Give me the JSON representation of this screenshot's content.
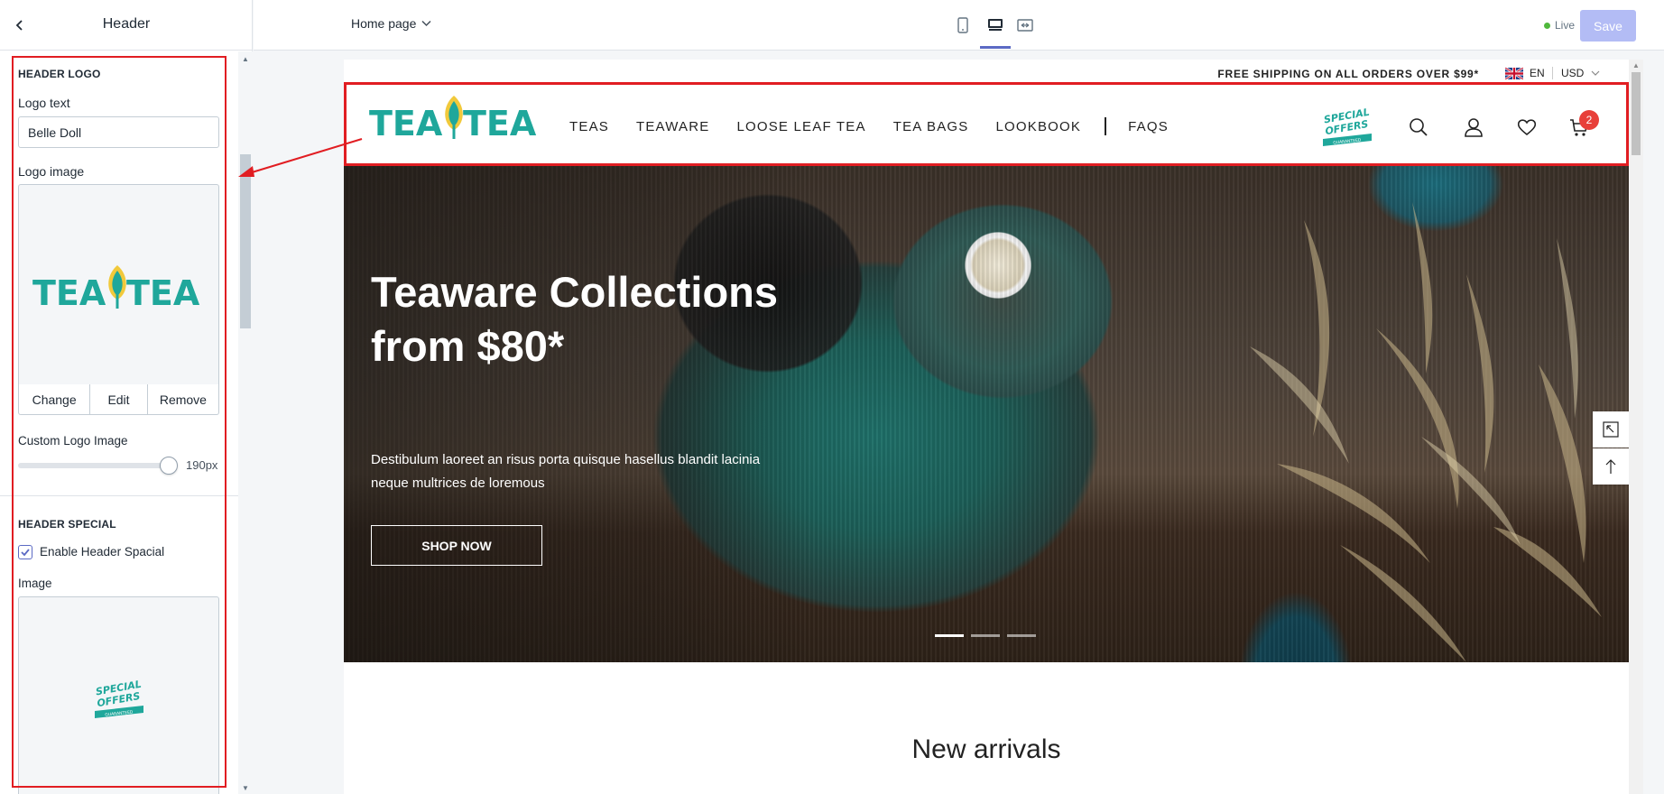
{
  "panel": {
    "title": "Header",
    "logo_section_title": "HEADER LOGO",
    "logo_text_label": "Logo text",
    "logo_text_value": "Belle Doll",
    "logo_image_label": "Logo image",
    "logo_actions": {
      "change": "Change",
      "edit": "Edit",
      "remove": "Remove"
    },
    "custom_logo_label": "Custom Logo Image",
    "custom_logo_value": "190px",
    "custom_logo_slider_fraction": 1.0,
    "special_section_title": "HEADER SPECIAL",
    "enable_special_label": "Enable Header Spacial",
    "enable_special_checked": true,
    "special_image_label": "Image"
  },
  "topbar": {
    "page_select": "Home page",
    "live_label": "Live",
    "save_label": "Save"
  },
  "logo": {
    "left": "TEA",
    "right": "TEA"
  },
  "special_badge": {
    "line1": "SPECIAL",
    "line2": "OFFERS",
    "ribbon": "GUARANTEED"
  },
  "store": {
    "announcement": "FREE SHIPPING ON ALL ORDERS OVER $99*",
    "language": "EN",
    "currency": "USD",
    "nav": [
      "TEAS",
      "TEAWARE",
      "LOOSE LEAF TEA",
      "TEA BAGS",
      "LOOKBOOK",
      "FAQS"
    ],
    "cart_count": "2"
  },
  "hero": {
    "title": "Teaware Collections from $80*",
    "subtitle": "Destibulum laoreet an risus porta quisque hasellus blandit lacinia neque multrices de loremous",
    "button": "SHOP NOW",
    "slide_count": 3,
    "active_slide": 1
  },
  "section_title": "New arrivals",
  "colors": {
    "brand_teal": "#1fa79b",
    "leaf_yellow": "#f1c93b",
    "highlight_red": "#e11d22",
    "accent": "#5c6ac4",
    "cart_badge": "#e8403a"
  }
}
